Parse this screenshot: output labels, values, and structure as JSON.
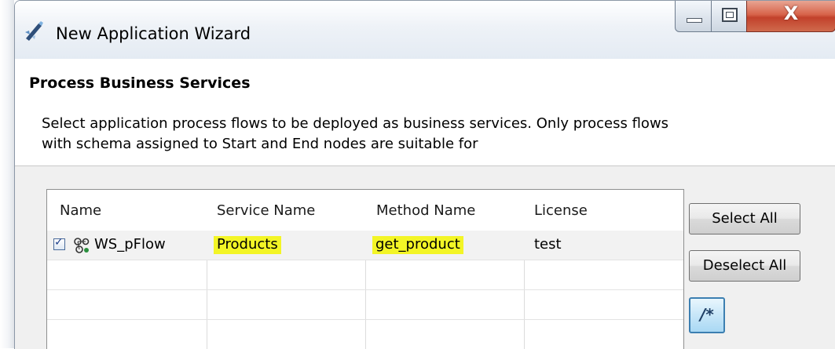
{
  "window": {
    "title": "New Application Wizard",
    "icons": {
      "app": "wizard-wand-icon",
      "minimize": "minimize-icon",
      "maximize": "maximize-icon",
      "close": "close-icon"
    },
    "close_glyph": "X"
  },
  "header": {
    "title": "Process Business Services",
    "description": "Select application process flows to be deployed as business services. Only process flows with schema assigned to Start and End nodes are suitable for"
  },
  "table": {
    "columns": [
      "Name",
      "Service Name",
      "Method Name",
      "License"
    ],
    "rows": [
      {
        "checked": true,
        "name": "WS_pFlow",
        "service_name": "Products",
        "method_name": "get_product",
        "license": "test",
        "icon": "process-flow-icon"
      }
    ],
    "highlight_color": "#f3f526"
  },
  "buttons": {
    "select_all": "Select All",
    "deselect_all": "Deselect All",
    "comment": "/*"
  }
}
